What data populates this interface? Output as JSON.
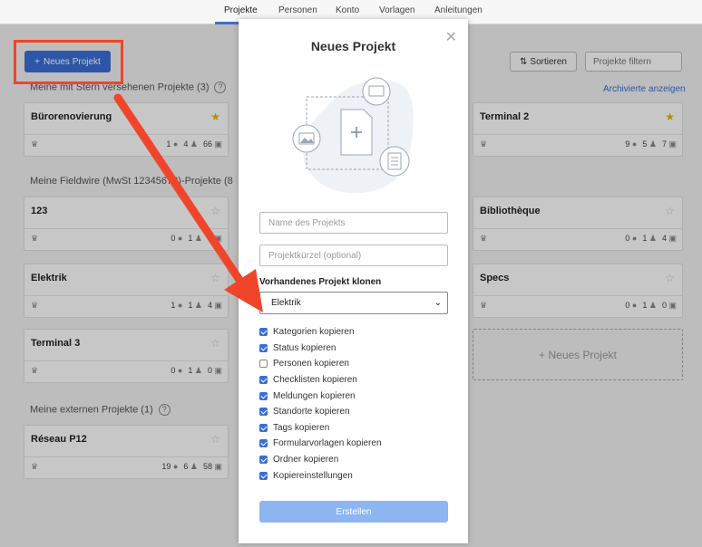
{
  "nav": {
    "items": [
      "Projekte",
      "Personen",
      "Konto",
      "Vorlagen",
      "Anleitungen"
    ]
  },
  "toolbar": {
    "new_project_label": "Neues Projekt",
    "sort_label": "Sortieren",
    "filter_placeholder": "Projekte filtern",
    "archived_link": "Archivierte anzeigen"
  },
  "sections": {
    "starred": "Meine mit Stern versehenen Projekte (3)",
    "fieldwire": "Meine Fieldwire (MwSt 12345678)-Projekte (8",
    "external": "Meine externen Projekte (1)"
  },
  "projects_left": [
    {
      "name": "Bürorenovierung",
      "starred": true,
      "a": "1",
      "b": "4",
      "c": "66"
    },
    {
      "name": "123",
      "starred": false,
      "a": "0",
      "b": "1",
      "c": "4"
    },
    {
      "name": "Elektrik",
      "starred": false,
      "a": "1",
      "b": "1",
      "c": "4"
    },
    {
      "name": "Terminal 3",
      "starred": false,
      "a": "0",
      "b": "1",
      "c": "0"
    },
    {
      "name": "Réseau P12",
      "starred": false,
      "a": "19",
      "b": "6",
      "c": "58"
    }
  ],
  "projects_right": [
    {
      "name": "Terminal 2",
      "starred": true,
      "a": "9",
      "b": "5",
      "c": "7"
    },
    {
      "name": "Bibliothèque",
      "starred": false,
      "a": "0",
      "b": "1",
      "c": "4"
    },
    {
      "name": "Specs",
      "starred": false,
      "a": "0",
      "b": "1",
      "c": "0"
    }
  ],
  "new_project_card": "+ Neues Projekt",
  "modal": {
    "title": "Neues Projekt",
    "name_placeholder": "Name des Projekts",
    "short_placeholder": "Projektkürzel (optional)",
    "clone_label": "Vorhandenes Projekt klonen",
    "clone_selected": "Elektrik",
    "options": [
      {
        "label": "Kategorien kopieren",
        "checked": true
      },
      {
        "label": "Status kopieren",
        "checked": true
      },
      {
        "label": "Personen kopieren",
        "checked": false
      },
      {
        "label": "Checklisten kopieren",
        "checked": true
      },
      {
        "label": "Meldungen kopieren",
        "checked": true
      },
      {
        "label": "Standorte kopieren",
        "checked": true
      },
      {
        "label": "Tags kopieren",
        "checked": true
      },
      {
        "label": "Formularvorlagen kopieren",
        "checked": true
      },
      {
        "label": "Ordner kopieren",
        "checked": true
      },
      {
        "label": "Kopiereinstellungen",
        "checked": true
      }
    ],
    "create_label": "Erstellen"
  },
  "colors": {
    "accent": "#3a6fd8",
    "annotation": "#f0452a",
    "star": "#e6b800"
  }
}
